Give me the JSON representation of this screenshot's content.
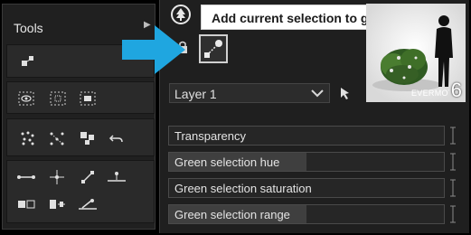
{
  "tools": {
    "title": "Tools"
  },
  "tooltip": {
    "text": "Add current selection to group"
  },
  "layer": {
    "selected": "Layer 1"
  },
  "thumbnail": {
    "count": "6",
    "brand": "EVERMOTION"
  },
  "sliders": [
    {
      "label": "Transparency",
      "value": 0.0
    },
    {
      "label": "Green selection hue",
      "value": 0.5
    },
    {
      "label": "Green selection saturation",
      "value": 0.0
    },
    {
      "label": "Green selection range",
      "value": 0.5
    }
  ],
  "colors": {
    "arrow": "#1fa6e0",
    "panel": "#1f1f1f",
    "tooltip_bg": "#ffffff"
  }
}
